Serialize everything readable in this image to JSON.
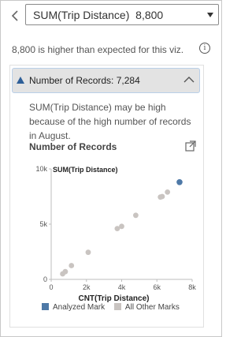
{
  "header": {
    "back_icon": "chevron-left-icon",
    "measure_select": {
      "field": "SUM(Trip Distance)",
      "value": "8,800"
    },
    "dropdown_icon": "caret-down-icon"
  },
  "summary": {
    "text": "8,800 is higher than expected for this viz.",
    "info_icon": "info-icon"
  },
  "explanation": {
    "header_label": "Number of Records: 7,284",
    "body": "SUM(Trip Distance) may be high because of the high number of records in August.",
    "chart_title": "Number of Records",
    "share_icon": "open-in-new-window-icon",
    "colors": {
      "analyzed": "#4e79a7",
      "other": "#c9c4c1",
      "header_bg": "#e3e3e3",
      "header_border": "#b9cfe8"
    }
  },
  "chart_data": {
    "type": "scatter",
    "xlabel": "CNT(Trip Distance)",
    "ylabel": "SUM(Trip Distance)",
    "xlim": [
      0,
      8000
    ],
    "ylim": [
      0,
      10000
    ],
    "x_ticks": [
      "0",
      "2k",
      "4k",
      "6k",
      "8k"
    ],
    "y_ticks": [
      "0",
      "5k",
      "10k"
    ],
    "grid": false,
    "legend": {
      "position": "bottom-left",
      "entries": [
        "Analyzed Mark",
        "All Other Marks"
      ]
    },
    "series": [
      {
        "name": "All Other Marks",
        "points": [
          {
            "x": 650,
            "y": 500
          },
          {
            "x": 800,
            "y": 700
          },
          {
            "x": 1150,
            "y": 1250
          },
          {
            "x": 2100,
            "y": 2450
          },
          {
            "x": 3750,
            "y": 4600
          },
          {
            "x": 4000,
            "y": 4800
          },
          {
            "x": 4800,
            "y": 5800
          },
          {
            "x": 6200,
            "y": 7450
          },
          {
            "x": 6300,
            "y": 7500
          },
          {
            "x": 6600,
            "y": 7900
          }
        ]
      },
      {
        "name": "Analyzed Mark",
        "points": [
          {
            "x": 7284,
            "y": 8800
          }
        ]
      }
    ]
  }
}
